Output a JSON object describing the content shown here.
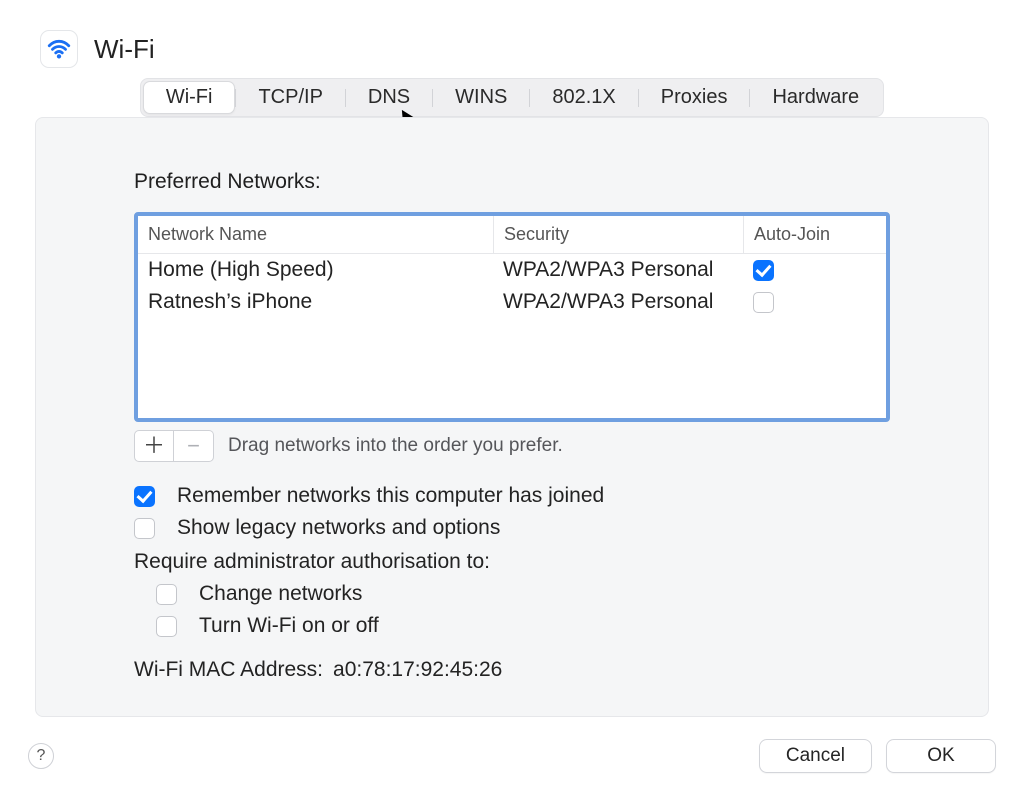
{
  "header": {
    "title": "Wi-Fi"
  },
  "tabs": {
    "items": [
      "Wi-Fi",
      "TCP/IP",
      "DNS",
      "WINS",
      "802.1X",
      "Proxies",
      "Hardware"
    ],
    "active": 0
  },
  "preferred": {
    "label": "Preferred Networks:",
    "columns": {
      "name": "Network Name",
      "security": "Security",
      "auto": "Auto-Join"
    },
    "rows": [
      {
        "name": "Home (High Speed)",
        "security": "WPA2/WPA3 Personal",
        "auto_join": true
      },
      {
        "name": "Ratnesh’s iPhone",
        "security": "WPA2/WPA3 Personal",
        "auto_join": false
      }
    ],
    "drag_hint": "Drag networks into the order you prefer."
  },
  "options": {
    "remember": {
      "label": "Remember networks this computer has joined",
      "checked": true
    },
    "legacy": {
      "label": "Show legacy networks and options",
      "checked": false
    },
    "require_label": "Require administrator authorisation to:",
    "req_change": {
      "label": "Change networks",
      "checked": false
    },
    "req_toggle": {
      "label": "Turn Wi-Fi on or off",
      "checked": false
    }
  },
  "mac": {
    "label": "Wi-Fi MAC Address:",
    "value": "a0:78:17:92:45:26"
  },
  "footer": {
    "help": "?",
    "cancel": "Cancel",
    "ok": "OK"
  }
}
